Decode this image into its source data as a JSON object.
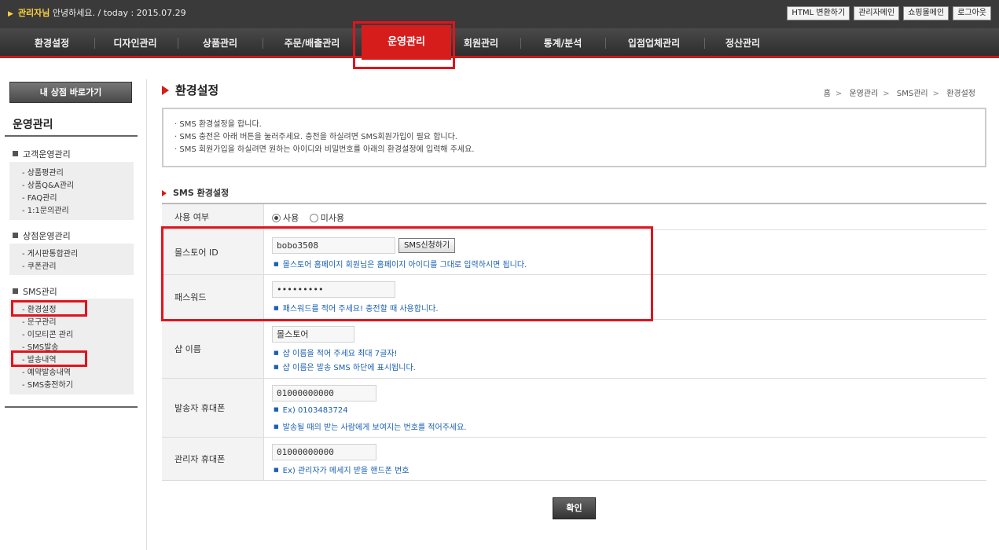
{
  "header": {
    "user_name": "관리자님",
    "greeting": "안녕하세요. / today : 2015.07.29",
    "links": [
      "HTML 변환하기",
      "관리자메인",
      "쇼핑몰메인",
      "로그아웃"
    ]
  },
  "nav": {
    "items": [
      "환경설정",
      "디자인관리",
      "상품관리",
      "주문/배출관리",
      "운영관리",
      "회원관리",
      "통계/분석",
      "입점업체관리",
      "정산관리"
    ],
    "active": "운영관리"
  },
  "sidebar": {
    "shop_button": "내 상점 바로가기",
    "title": "운영관리",
    "groups": [
      {
        "title": "고객운영관리",
        "items": [
          "- 상품평관리",
          "- 상품Q&A관리",
          "- FAQ관리",
          "- 1:1문의관리"
        ]
      },
      {
        "title": "상점운영관리",
        "items": [
          "- 게시판통합관리",
          "- 쿠폰관리"
        ]
      },
      {
        "title": "SMS관리",
        "items": [
          "- 환경설정",
          "- 문구관리",
          "- 이모티콘 관리",
          "- SMS발송",
          "- 발송내역",
          "- 예약발송내역",
          "- SMS충전하기"
        ]
      }
    ]
  },
  "page": {
    "title": "환경설정",
    "breadcrumb": [
      "홈",
      "운영관리",
      "SMS관리",
      "환경설정"
    ],
    "notice": [
      "· SMS 환경설정을 합니다.",
      "· SMS 충전은 아래 버튼을 눌러주세요. 충전을 하실려면 SMS회원가입이 필요 합니다.",
      "· SMS 회원가입을 하실려면 원하는 아이디와 비밀번호를 아래의 환경설정에 입력해 주세요."
    ],
    "section_title": "SMS 환경설정"
  },
  "form": {
    "usage": {
      "label": "사용 여부",
      "option_on": "사용",
      "option_off": "미사용",
      "selected": "사용"
    },
    "store_id": {
      "label": "몰스토어 ID",
      "value": "bobo3508",
      "button": "SMS신청하기",
      "hint": "몰스토어 홈페이지 회원님은 홈페이지 아이디를 그대로 입력하시면 됩니다."
    },
    "password": {
      "label": "패스워드",
      "value": "•••••••••",
      "hint": "패스워드를 적어 주세요! 충전할 때 사용합니다."
    },
    "shop_name": {
      "label": "샵 이름",
      "value": "몰스토어",
      "hints": [
        "샵 이름을 적어 주세요 최대 7글자!",
        "샵 이름은 발송 SMS 하단에 표시됩니다."
      ]
    },
    "sender_phone": {
      "label": "발송자 휴대폰",
      "value": "01000000000",
      "hints": [
        "Ex) 0103483724",
        "발송될 때의 받는 사람에게 보여지는 번호를 적어주세요."
      ]
    },
    "admin_phone": {
      "label": "관리자 휴대폰",
      "value": "01000000000",
      "hints": [
        "Ex) 관리자가 메세지 받을 핸드폰 번호"
      ]
    }
  },
  "confirm_button": "확인",
  "colors": {
    "accent": "#d71c1c",
    "highlight": "#e0141e",
    "hint": "#1a5fb4"
  }
}
